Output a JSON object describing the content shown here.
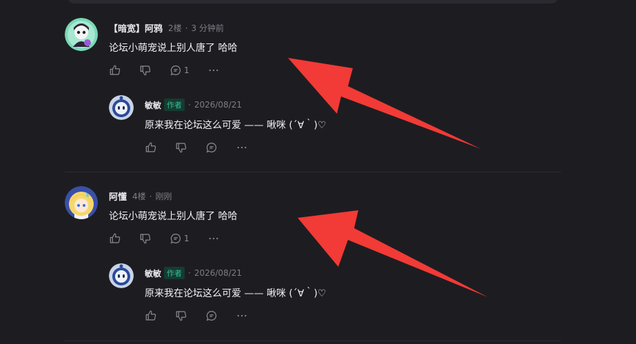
{
  "comments": [
    {
      "username": "【暗宽】阿鸦",
      "floor": "2楼",
      "time": "3 分钟前",
      "text": "论坛小萌宠说上别人唐了 哈哈",
      "reply_count": "1",
      "reply": {
        "username": "敏敏",
        "badge": "作者",
        "time": "2026/08/21",
        "text": "原来我在论坛这么可爱 —— 啾咪 (´∀｀)♡"
      }
    },
    {
      "username": "阿懂",
      "floor": "4楼",
      "time": "刚刚",
      "text": "论坛小萌宠说上别人唐了 哈哈",
      "reply_count": "1",
      "reply": {
        "username": "敏敏",
        "badge": "作者",
        "time": "2026/08/21",
        "text": "原来我在论坛这么可爱 —— 啾咪 (´∀｀)♡"
      }
    }
  ],
  "separator": "·",
  "icons": {
    "like": "thumbs-up-icon",
    "dislike": "thumbs-down-icon",
    "reply": "comment-bubble-icon",
    "more": "more-dots-icon"
  },
  "colors": {
    "background": "#1d1d21",
    "author_badge_text": "#2fbf93",
    "author_badge_bg": "#173b31",
    "annotation_arrow": "#f23a36"
  }
}
